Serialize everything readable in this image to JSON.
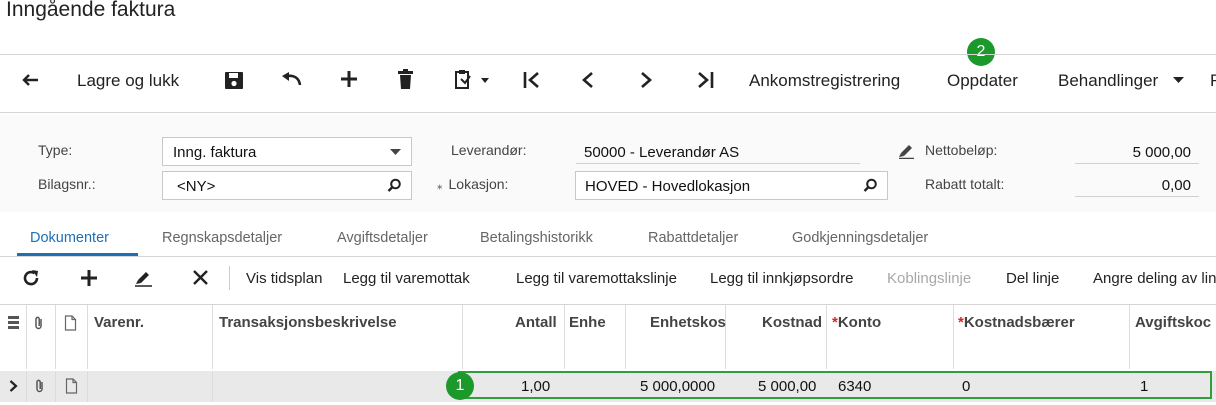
{
  "page": {
    "title": "Inngående faktura"
  },
  "toolbar": {
    "save_close": "Lagre og lukk",
    "ankomst": "Ankomstregistrering",
    "oppdater": "Oppdater",
    "behandlinger": "Behandlinger",
    "more": "R"
  },
  "form": {
    "type_label": "Type:",
    "type_value": "Inng. faktura",
    "bilag_label": "Bilagsnr.:",
    "bilag_value": "<NY>",
    "leverandor_label": "Leverandør:",
    "leverandor_value": "50000 - Leverandør AS",
    "lokasjon_label": "Lokasjon:",
    "lokasjon_value": "HOVED - Hovedlokasjon",
    "netto_label": "Nettobeløp:",
    "netto_value": "5 000,00",
    "rabatt_label": "Rabatt totalt:",
    "rabatt_value": "0,00"
  },
  "tabs": [
    "Dokumenter",
    "Regnskapsdetaljer",
    "Avgiftsdetaljer",
    "Betalingshistorikk",
    "Rabattdetaljer",
    "Godkjenningsdetaljer"
  ],
  "grid_toolbar": {
    "vis_tidsplan": "Vis tidsplan",
    "legg_varemottak": "Legg til varemottak",
    "legg_varemottakslinje": "Legg til varemottakslinje",
    "legg_innkjopsordre": "Legg til innkjøpsordre",
    "koblingslinje": "Koblingslinje",
    "del_linje": "Del linje",
    "angre_deling": "Angre deling av lin"
  },
  "columns": {
    "varenr": "Varenr.",
    "beskrivelse": "Transaksjonsbeskrivelse",
    "antall": "Antall",
    "enhet": "Enhe",
    "enhetskost": "Enhetskos",
    "kostnad": "Kostnad",
    "konto": "Konto",
    "kostnadsbaerer": "Kostnadsbærer",
    "avgiftskode": "Avgiftskoc"
  },
  "row": {
    "antall": "1,00",
    "enhetskost": "5 000,0000",
    "kostnad": "5 000,00",
    "konto": "6340",
    "kostnadsbaerer": "0",
    "avgiftskode": "1"
  },
  "badges": {
    "one": "1",
    "two": "2"
  },
  "colors": {
    "accent": "#1f6fb5",
    "badge": "#1b9a2b",
    "required": "#dd2222"
  }
}
